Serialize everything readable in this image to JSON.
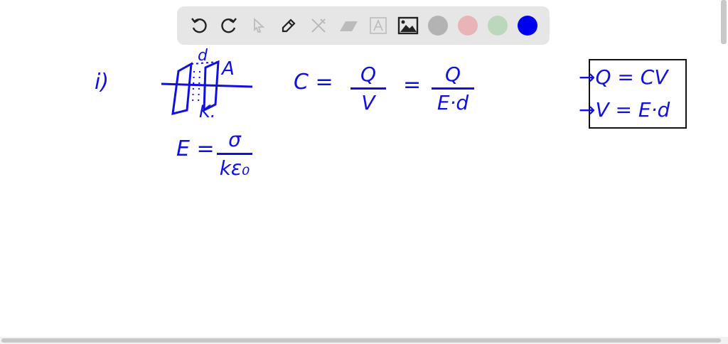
{
  "toolbar": {
    "tools": [
      "undo-icon",
      "redo-icon",
      "select-icon",
      "pen-icon",
      "tools-icon",
      "eraser-icon",
      "text-icon",
      "image-icon"
    ],
    "colors": [
      "#b3b3b3",
      "#e8b4b8",
      "#bcd8bc",
      "#0000ee"
    ]
  },
  "canvas": {
    "label_i": "i)",
    "plate_d": "d",
    "plate_A": "A",
    "plate_K": "K.",
    "c_eq": "C =",
    "frac1_num": "Q",
    "frac1_den": "V",
    "eq2": "=",
    "frac2_num": "Q",
    "frac2_den": "E·d",
    "e_eq": "E =",
    "frac3_num": "σ",
    "frac3_den": "kε₀",
    "box_line1": "→Q = CV",
    "box_line2": "→V = E·d"
  }
}
